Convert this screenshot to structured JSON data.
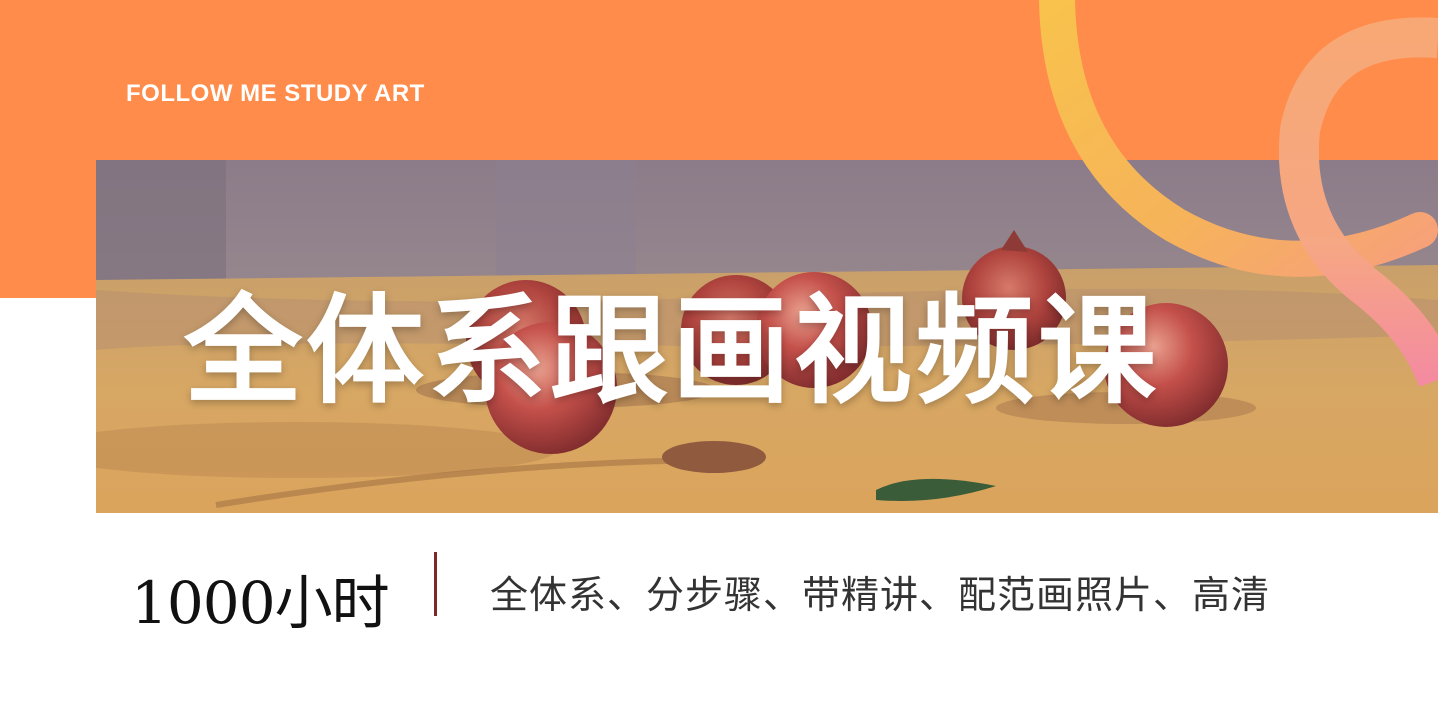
{
  "banner": {
    "kicker": "FOLLOW ME STUDY ART",
    "title": "全体系跟画视频课",
    "hours": "1000小时",
    "features": "全体系、分步骤、带精讲、配范画照片、高清"
  },
  "colors": {
    "orange": "#FF8C4B",
    "ring_yellow": "#F7C04E",
    "ring_pink": "#F48BA0",
    "divider": "#7A2A2A"
  },
  "image": {
    "description": "still-life oil painting of red fruits on a table"
  }
}
